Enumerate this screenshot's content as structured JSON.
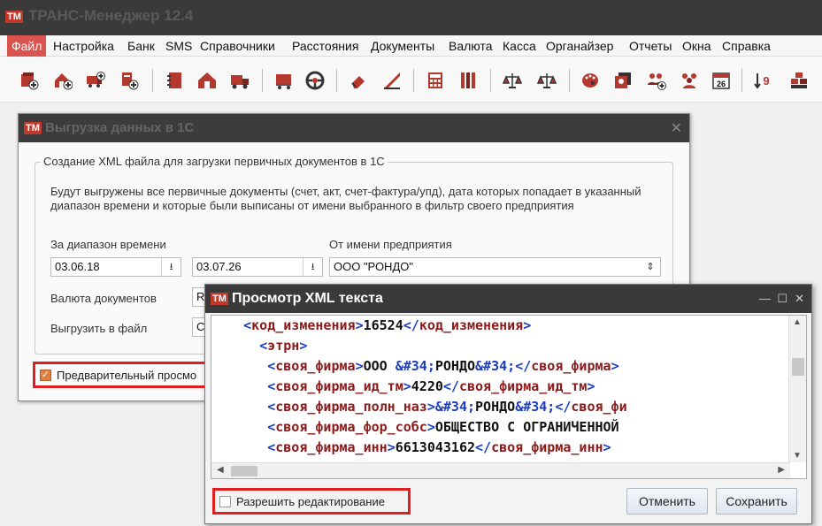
{
  "app": {
    "logo": "TM",
    "title": "ТРАНС-Менеджер 12.4"
  },
  "menu": [
    "Файл",
    "Настройка",
    "Банк",
    "SMS",
    "Справочники",
    "Расстояния",
    "Документы",
    "Валюта",
    "Касса",
    "Органайзер",
    "Отчеты",
    "Окна",
    "Справка"
  ],
  "toolbar_icons": [
    "add-client-icon",
    "add-house-icon",
    "add-truck-icon",
    "add-document-icon",
    "notebook-icon",
    "house-icon",
    "truck-icon",
    "lorry-icon",
    "steering-wheel-icon",
    "eraser-icon",
    "ruler-icon",
    "calculator-icon",
    "binders-icon",
    "scales-add-icon",
    "scales-icon",
    "palette-icon",
    "photos-icon",
    "add-users-icon",
    "users-icon",
    "calendar-icon",
    "sort-icon",
    "boxes-icon"
  ],
  "calendar_day": "26",
  "dialog_export": {
    "logo": "TM",
    "title": "Выгрузка данных в 1С",
    "group_title": "Создание XML файла для загрузки первичных документов в 1С",
    "description": "Будут выгружены все первичные документы (счет, акт, счет-фактура/упд), дата которых попадает в указанный диапазон времени и которые были выписаны от имени выбранного в фильтр своего предприятия",
    "label_range": "За диапазон времени",
    "date_from": "03.06.18",
    "date_to": "03.07.26",
    "label_company": "От имени предприятия",
    "company": "ООО \"РОНДО\"",
    "label_currency": "Валюта документов",
    "currency_partial": "R",
    "label_file": "Выгрузить в файл",
    "file_partial": "C",
    "preview_checkbox": "Предварительный просмо",
    "preview_checked": true
  },
  "dialog_xml": {
    "logo": "TM",
    "title": "Просмотр XML текста",
    "lines": [
      {
        "indent": "    ",
        "parts": [
          [
            "br",
            "<"
          ],
          [
            "tg",
            "код_изменения"
          ],
          [
            "br",
            ">"
          ],
          [
            "tx",
            "16524"
          ],
          [
            "br",
            "</"
          ],
          [
            "tg",
            "код_изменения"
          ],
          [
            "br",
            ">"
          ]
        ]
      },
      {
        "indent": "      ",
        "parts": [
          [
            "br",
            "<"
          ],
          [
            "tg",
            "этрн"
          ],
          [
            "br",
            ">"
          ]
        ]
      },
      {
        "indent": "       ",
        "parts": [
          [
            "br",
            "<"
          ],
          [
            "tg",
            "своя_фирма"
          ],
          [
            "br",
            ">"
          ],
          [
            "tx",
            "ООО "
          ],
          [
            "en",
            "&#34;"
          ],
          [
            "tx",
            "РОНДО"
          ],
          [
            "en",
            "&#34;"
          ],
          [
            "br",
            "</"
          ],
          [
            "tg",
            "своя_фирма"
          ],
          [
            "br",
            ">"
          ]
        ]
      },
      {
        "indent": "       ",
        "parts": [
          [
            "br",
            "<"
          ],
          [
            "tg",
            "своя_фирма_ид_тм"
          ],
          [
            "br",
            ">"
          ],
          [
            "tx",
            "4220"
          ],
          [
            "br",
            "</"
          ],
          [
            "tg",
            "своя_фирма_ид_тм"
          ],
          [
            "br",
            ">"
          ]
        ]
      },
      {
        "indent": "       ",
        "parts": [
          [
            "br",
            "<"
          ],
          [
            "tg",
            "своя_фирма_полн_наз"
          ],
          [
            "br",
            ">"
          ],
          [
            "en",
            "&#34;"
          ],
          [
            "tx",
            "РОНДО"
          ],
          [
            "en",
            "&#34;"
          ],
          [
            "br",
            "</"
          ],
          [
            "tg",
            "своя_фи"
          ]
        ]
      },
      {
        "indent": "       ",
        "parts": [
          [
            "br",
            "<"
          ],
          [
            "tg",
            "своя_фирма_фор_собс"
          ],
          [
            "br",
            ">"
          ],
          [
            "tx",
            "ОБЩЕСТВО С ОГРАНИЧЕННОЙ"
          ]
        ]
      },
      {
        "indent": "       ",
        "parts": [
          [
            "br",
            "<"
          ],
          [
            "tg",
            "своя_фирма_инн"
          ],
          [
            "br",
            ">"
          ],
          [
            "tx",
            "6613043162"
          ],
          [
            "br",
            "</"
          ],
          [
            "tg",
            "своя_фирма_инн"
          ],
          [
            "br",
            ">"
          ]
        ]
      }
    ],
    "allow_edit": "Разрешить редактирование",
    "allow_edit_checked": false,
    "cancel": "Отменить",
    "save": "Сохранить"
  },
  "colors": {
    "accent_red": "#d9534f",
    "title_bar": "#3a3a3a",
    "xml_tag": "#8b1a1a",
    "xml_bracket": "#1a3cc4",
    "highlight_box": "#e02020"
  }
}
